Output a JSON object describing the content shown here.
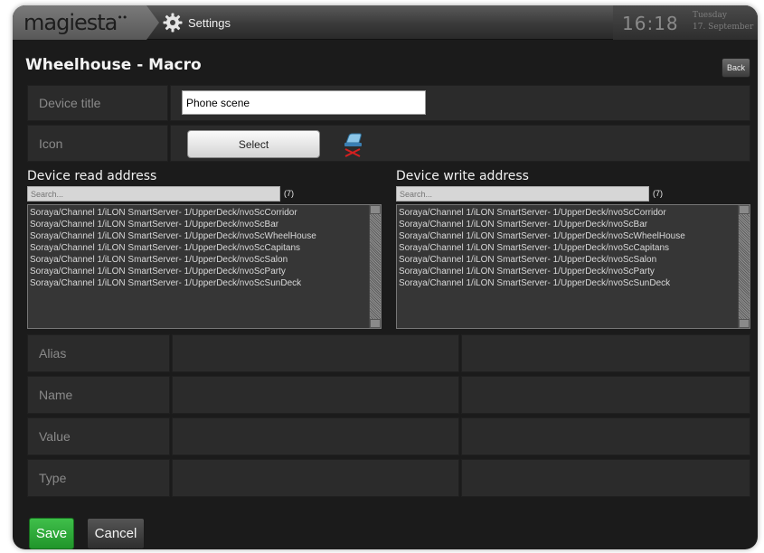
{
  "topbar": {
    "logo_text": "magiesta",
    "logo_mark": "••",
    "breadcrumb_label": "Settings",
    "breadcrumb_icon": "gear-icon",
    "time": "16:18",
    "day": "Tuesday",
    "date": "17. September"
  },
  "page": {
    "title": "Wheelhouse - Macro",
    "back_label": "Back"
  },
  "form": {
    "device_title_label": "Device title",
    "device_title_value": "Phone scene",
    "icon_label": "Icon",
    "select_label": "Select",
    "icon_preview": "iron-icon"
  },
  "read_address": {
    "title": "Device read address",
    "search_placeholder": "Search...",
    "count": "(7)",
    "items": [
      "Soraya/Channel 1/iLON SmartServer- 1/UpperDeck/nvoScCorridor",
      "Soraya/Channel 1/iLON SmartServer- 1/UpperDeck/nvoScBar",
      "Soraya/Channel 1/iLON SmartServer- 1/UpperDeck/nvoScWheelHouse",
      "Soraya/Channel 1/iLON SmartServer- 1/UpperDeck/nvoScCapitans",
      "Soraya/Channel 1/iLON SmartServer- 1/UpperDeck/nvoScSalon",
      "Soraya/Channel 1/iLON SmartServer- 1/UpperDeck/nvoScParty",
      "Soraya/Channel 1/iLON SmartServer- 1/UpperDeck/nvoScSunDeck"
    ]
  },
  "write_address": {
    "title": "Device write address",
    "search_placeholder": "Search...",
    "count": "(7)",
    "items": [
      "Soraya/Channel 1/iLON SmartServer- 1/UpperDeck/nvoScCorridor",
      "Soraya/Channel 1/iLON SmartServer- 1/UpperDeck/nvoScBar",
      "Soraya/Channel 1/iLON SmartServer- 1/UpperDeck/nvoScWheelHouse",
      "Soraya/Channel 1/iLON SmartServer- 1/UpperDeck/nvoScCapitans",
      "Soraya/Channel 1/iLON SmartServer- 1/UpperDeck/nvoScSalon",
      "Soraya/Channel 1/iLON SmartServer- 1/UpperDeck/nvoScParty",
      "Soraya/Channel 1/iLON SmartServer- 1/UpperDeck/nvoScSunDeck"
    ]
  },
  "details": {
    "alias_label": "Alias",
    "name_label": "Name",
    "value_label": "Value",
    "type_label": "Type",
    "alias_read": "",
    "alias_write": "",
    "name_read": "",
    "name_write": "",
    "value_read": "",
    "value_write": "",
    "type_read": "",
    "type_write": ""
  },
  "footer": {
    "save_label": "Save",
    "cancel_label": "Cancel"
  },
  "colors": {
    "background": "#1b1b1b",
    "row": "#2b2b2b",
    "save_green": "#2aa534",
    "text_muted": "#8a8a8a"
  }
}
